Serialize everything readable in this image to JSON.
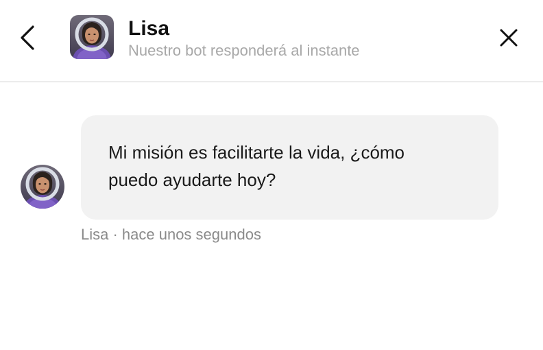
{
  "header": {
    "title": "Lisa",
    "subtitle": "Nuestro bot responderá al instante",
    "back_icon": "chevron-left-icon",
    "close_icon": "close-icon"
  },
  "conversation": {
    "messages": [
      {
        "text": "Mi misión es facilitarte la vida, ¿cómo\npuedo ayudarte hoy?",
        "meta": "Lisa · hace unos segundos"
      }
    ]
  },
  "colors": {
    "bubble_background": "#f2f2f2",
    "subtitle_text": "#a8a8a8",
    "meta_text": "#8a8a8a",
    "divider": "#ececec"
  }
}
